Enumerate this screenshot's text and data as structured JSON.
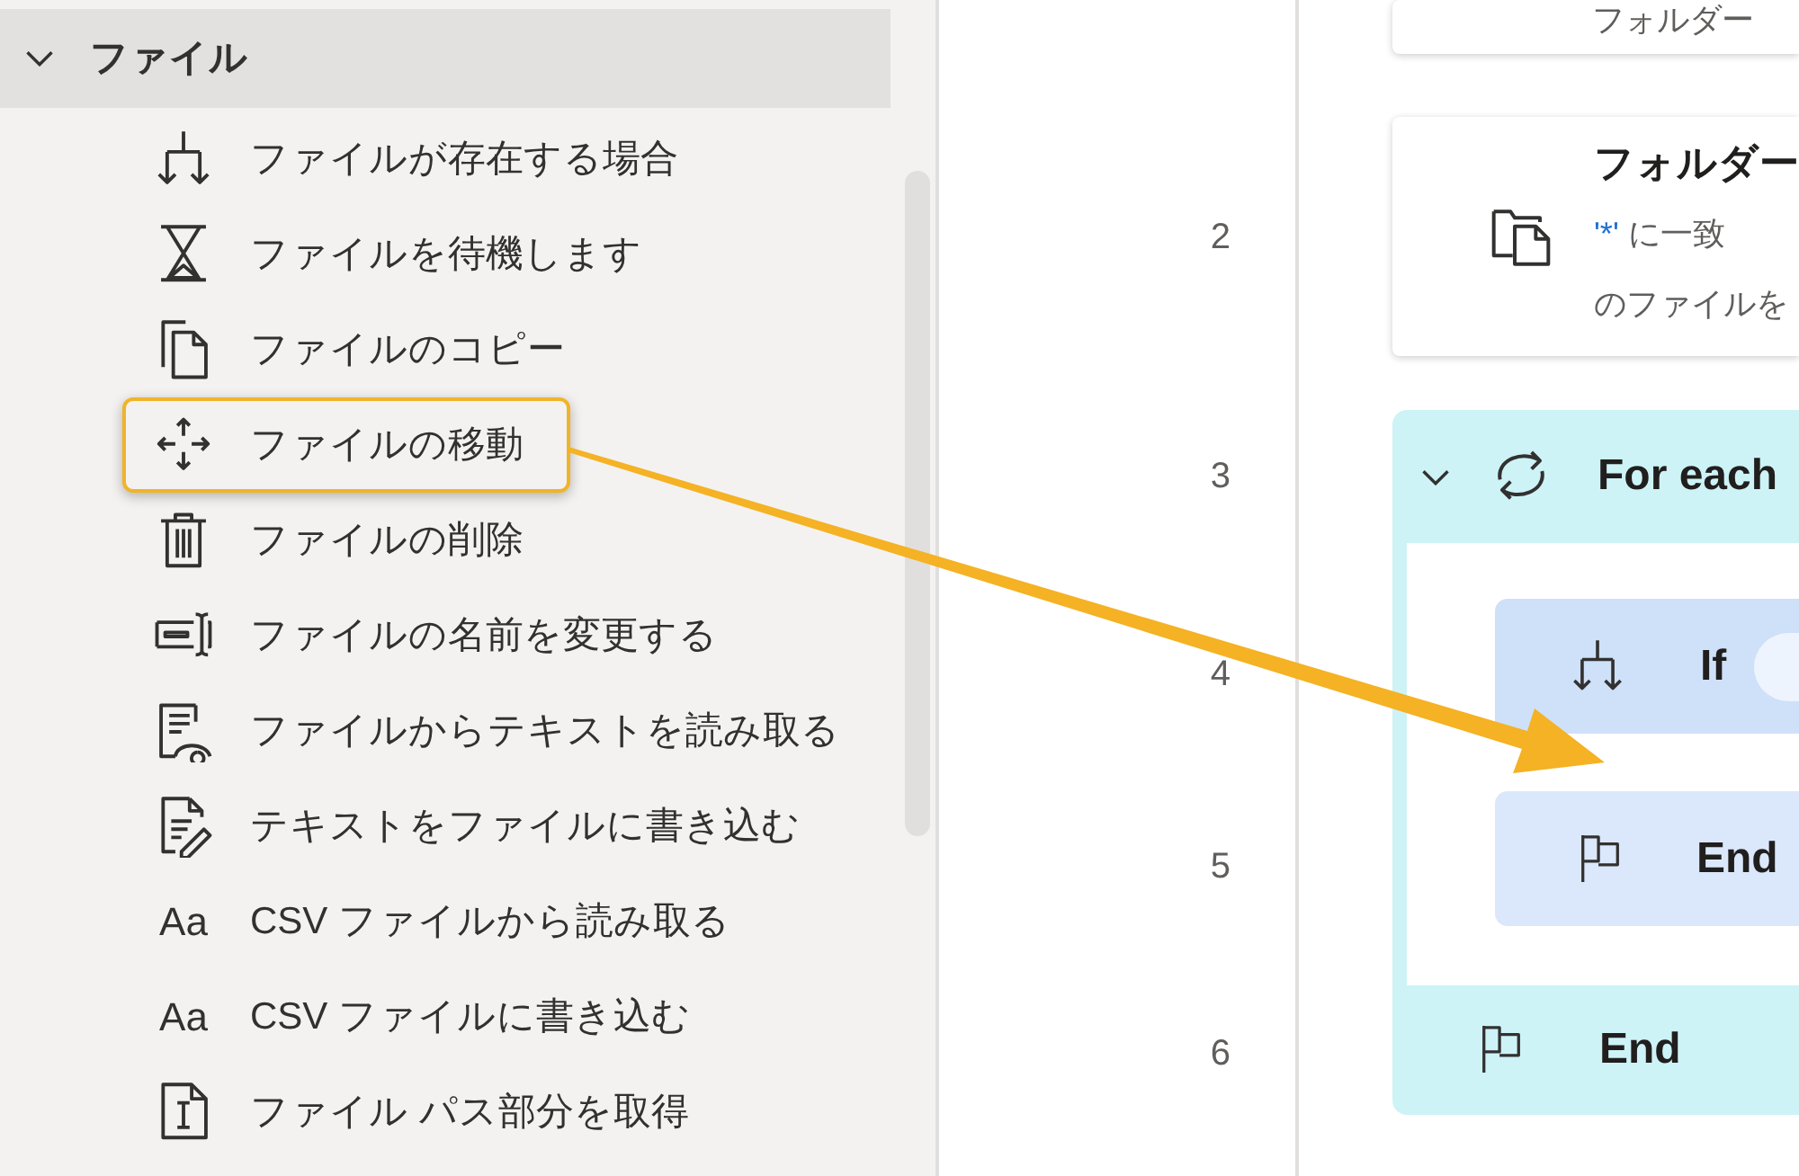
{
  "actions_panel": {
    "group": {
      "label": "ファイル",
      "expanded": true
    },
    "items": [
      {
        "label": "ファイルが存在する場合",
        "highlighted": false
      },
      {
        "label": "ファイルを待機します",
        "highlighted": false
      },
      {
        "label": "ファイルのコピー",
        "highlighted": false
      },
      {
        "label": "ファイルの移動",
        "highlighted": true
      },
      {
        "label": "ファイルの削除",
        "highlighted": false
      },
      {
        "label": "ファイルの名前を変更する",
        "highlighted": false
      },
      {
        "label": "ファイルからテキストを読み取る",
        "highlighted": false
      },
      {
        "label": "テキストをファイルに書き込む",
        "highlighted": false
      },
      {
        "label": "CSV ファイルから読み取る",
        "icon_text": "Aa",
        "highlighted": false
      },
      {
        "label": "CSV ファイルに書き込む",
        "icon_text": "Aa",
        "highlighted": false
      },
      {
        "label": "ファイル パス部分を取得",
        "highlighted": false
      }
    ]
  },
  "flow": {
    "steps": [
      {
        "kind": "action",
        "description": [
          [
            {
              "text": "フォルダー",
              "kind": "plain"
            }
          ]
        ]
      },
      {
        "kind": "action",
        "line": "2",
        "title": "フォルダー",
        "description": [
          [
            {
              "text": "'*'",
              "kind": "token"
            },
            {
              "text": " に一致",
              "kind": "plain"
            }
          ],
          [
            {
              "text": "のファイルを",
              "kind": "plain"
            }
          ]
        ]
      },
      {
        "kind": "loop",
        "line": "3",
        "title": "For each",
        "expanded": true,
        "children": [
          {
            "kind": "if",
            "line": "4",
            "title": "If"
          },
          {
            "kind": "end",
            "line": "5",
            "title": "End"
          }
        ],
        "end": {
          "line": "6",
          "title": "End"
        }
      }
    ]
  },
  "annotations": [
    {
      "kind": "arrow"
    }
  ]
}
